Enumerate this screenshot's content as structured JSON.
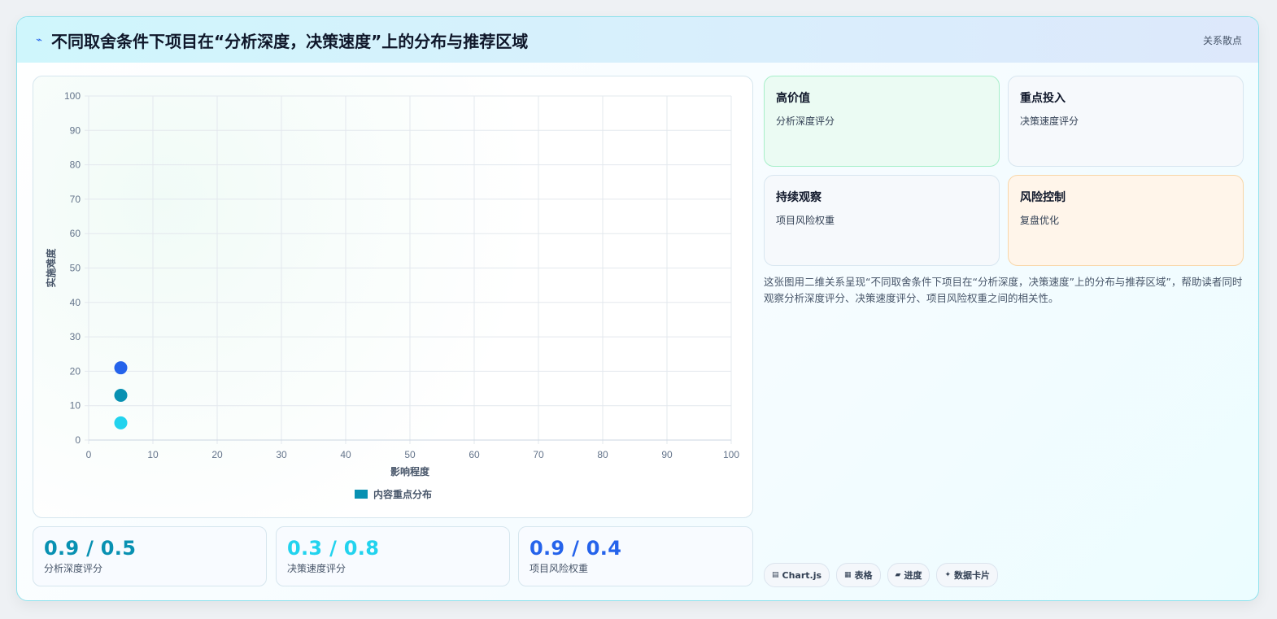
{
  "header": {
    "title": "不同取舍条件下项目在“分析深度，决策速度”上的分布与推荐区域",
    "tag": "关系散点",
    "icon": "lightning-icon"
  },
  "chart_data": {
    "type": "scatter",
    "xlabel": "影响程度",
    "ylabel": "实施难度",
    "xlim": [
      0,
      100
    ],
    "ylim": [
      0,
      100
    ],
    "xticks": [
      0,
      10,
      20,
      30,
      40,
      50,
      60,
      70,
      80,
      90,
      100
    ],
    "yticks": [
      0,
      10,
      20,
      30,
      40,
      50,
      60,
      70,
      80,
      90,
      100
    ],
    "grid": true,
    "legend_position": "bottom",
    "series": [
      {
        "name": "内容重点分布",
        "color": "#0891b2",
        "points": [
          {
            "x": 5,
            "y": 21,
            "color": "#2563eb"
          },
          {
            "x": 5,
            "y": 13,
            "color": "#0891b2"
          },
          {
            "x": 5,
            "y": 5,
            "color": "#22d3ee"
          }
        ]
      }
    ]
  },
  "stats": [
    {
      "value": "0.9 / 0.5",
      "label": "分析深度评分",
      "color": "#0891b2"
    },
    {
      "value": "0.3 / 0.8",
      "label": "决策速度评分",
      "color": "#22d3ee"
    },
    {
      "value": "0.9 / 0.4",
      "label": "项目风险权重",
      "color": "#2563eb"
    }
  ],
  "quadrants": [
    {
      "title": "高价值",
      "subtitle": "分析深度评分",
      "bg": "#ebfbf3",
      "border": "#a7efc9"
    },
    {
      "title": "重点投入",
      "subtitle": "决策速度评分",
      "bg": "#f6f9fc",
      "border": "#d8e6f0"
    },
    {
      "title": "持续观察",
      "subtitle": "项目风险权重",
      "bg": "#f6f9fc",
      "border": "#d8e6f0"
    },
    {
      "title": "风险控制",
      "subtitle": "复盘优化",
      "bg": "#fff5ea",
      "border": "#f8d6a8"
    }
  ],
  "description": "这张图用二维关系呈现“不同取舍条件下项目在“分析深度，决策速度”上的分布与推荐区域”，帮助读者同时观察分析深度评分、决策速度评分、项目风险权重之间的相关性。",
  "chips": [
    {
      "icon": "chart-icon",
      "glyph": "▤",
      "label": "Chart.js"
    },
    {
      "icon": "table-icon",
      "glyph": "▦",
      "label": "表格"
    },
    {
      "icon": "progress-icon",
      "glyph": "▰",
      "label": "进度"
    },
    {
      "icon": "data-card-icon",
      "glyph": "✦",
      "label": "数据卡片"
    }
  ]
}
